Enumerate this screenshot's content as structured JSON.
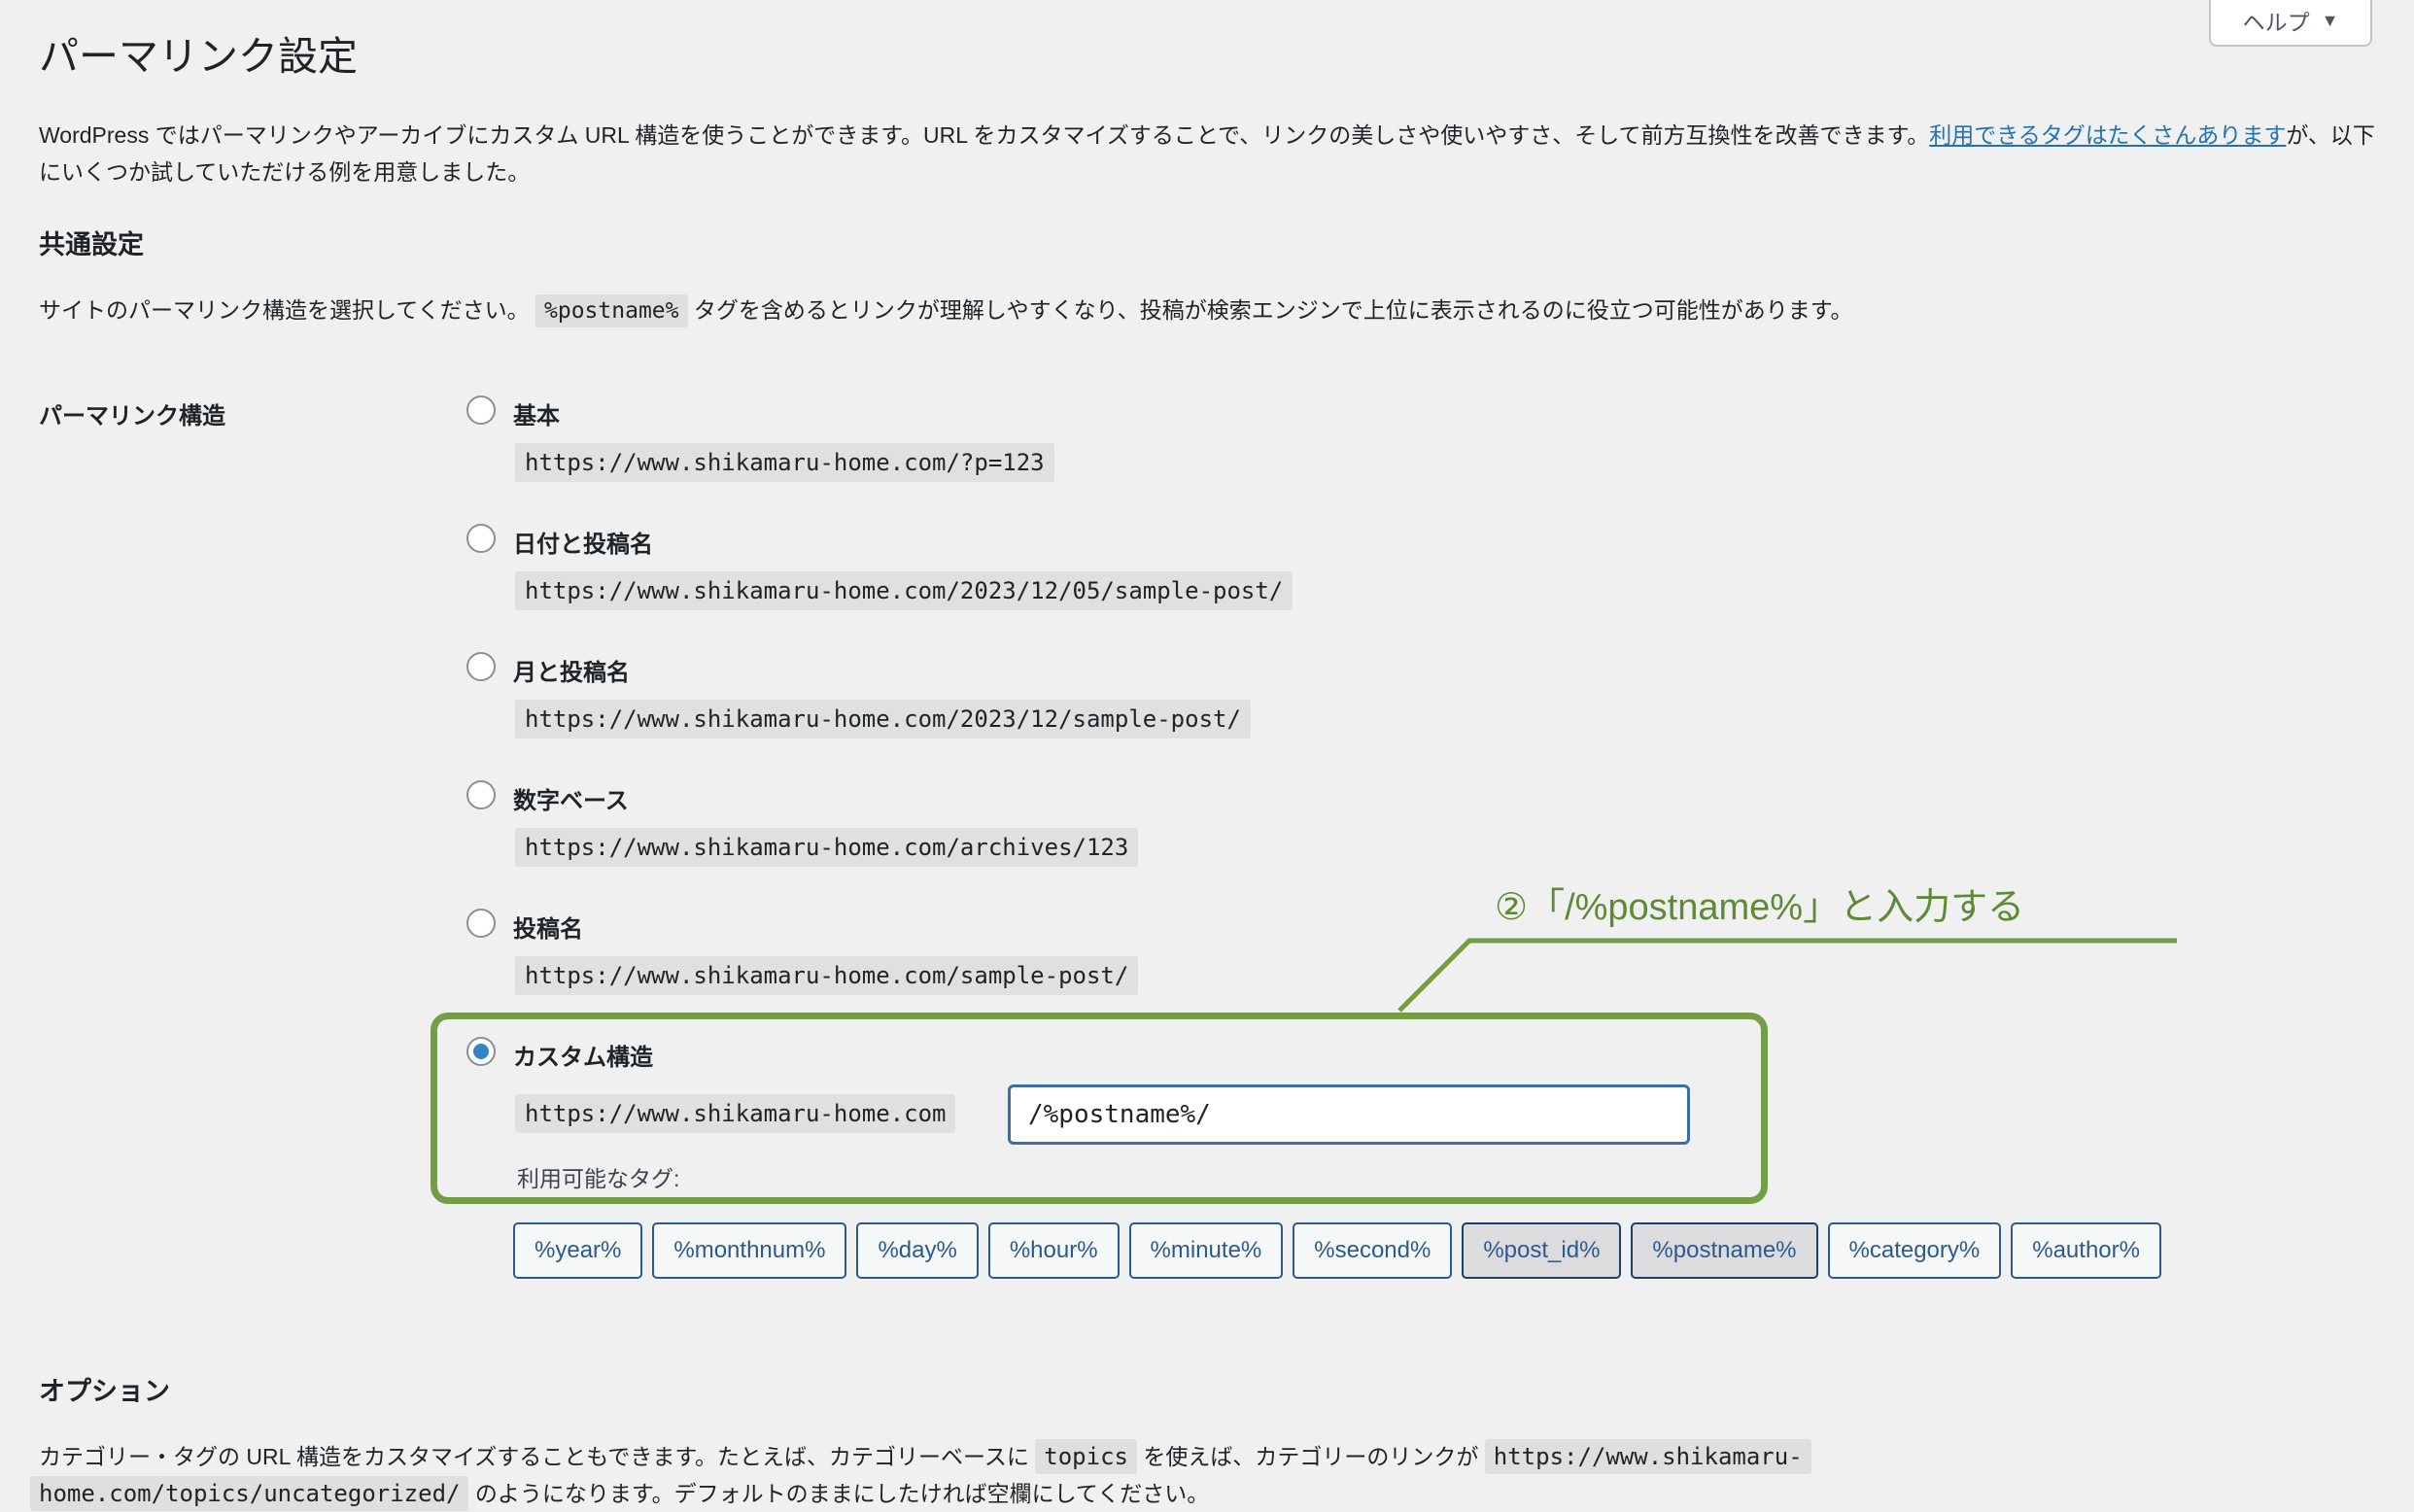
{
  "header": {
    "title": "パーマリンク設定",
    "help_label": "ヘルプ",
    "help_icon": "caret-down-icon"
  },
  "intro": {
    "text_before_link": "WordPress ではパーマリンクやアーカイブにカスタム URL 構造を使うことができます。URL をカスタマイズすることで、リンクの美しさや使いやすさ、そして前方互換性を改善できます。",
    "link_text": "利用できるタグはたくさんあります",
    "text_after_link": "が、以下にいくつか試していただける例を用意しました。"
  },
  "common": {
    "heading": "共通設定",
    "desc_before": "サイトのパーマリンク構造を選択してください。",
    "desc_code": "%postname%",
    "desc_after": "タグを含めるとリンクが理解しやすくなり、投稿が検索エンジンで上位に表示されるのに役立つ可能性があります。"
  },
  "permalink": {
    "row_label": "パーマリンク構造",
    "options": [
      {
        "label": "基本",
        "example": "https://www.shikamaru-home.com/?p=123",
        "checked": false
      },
      {
        "label": "日付と投稿名",
        "example": "https://www.shikamaru-home.com/2023/12/05/sample-post/",
        "checked": false
      },
      {
        "label": "月と投稿名",
        "example": "https://www.shikamaru-home.com/2023/12/sample-post/",
        "checked": false
      },
      {
        "label": "数字ベース",
        "example": "https://www.shikamaru-home.com/archives/123",
        "checked": false
      },
      {
        "label": "投稿名",
        "example": "https://www.shikamaru-home.com/sample-post/",
        "checked": false
      }
    ],
    "custom": {
      "label": "カスタム構造",
      "checked": true,
      "prefix": "https://www.shikamaru-home.com",
      "value": "/%postname%/",
      "available_tags_label": "利用可能なタグ:"
    },
    "tags": [
      {
        "label": "%year%",
        "active": false
      },
      {
        "label": "%monthnum%",
        "active": false
      },
      {
        "label": "%day%",
        "active": false
      },
      {
        "label": "%hour%",
        "active": false
      },
      {
        "label": "%minute%",
        "active": false
      },
      {
        "label": "%second%",
        "active": false
      },
      {
        "label": "%post_id%",
        "active": true
      },
      {
        "label": "%postname%",
        "active": true
      },
      {
        "label": "%category%",
        "active": false
      },
      {
        "label": "%author%",
        "active": false
      }
    ]
  },
  "annotation": {
    "text": "②「/%postname%」と入力する",
    "color": "#759d45"
  },
  "options": {
    "heading": "オプション",
    "text1": "カテゴリー・タグの URL 構造をカスタマイズすることもできます。たとえば、カテゴリーベースに",
    "code1": "topics",
    "text2": "を使えば、カテゴリーのリンクが",
    "code2a": "https://www.shikamaru-",
    "code2b": "home.com/topics/uncategorized/",
    "text3": "のようになります。デフォルトのままにしたければ空欄にしてください。"
  },
  "colors": {
    "accent": "#2271b1",
    "radio_checked": "#3582c4",
    "annotation_green": "#759d45",
    "background": "#f0f0f1"
  }
}
